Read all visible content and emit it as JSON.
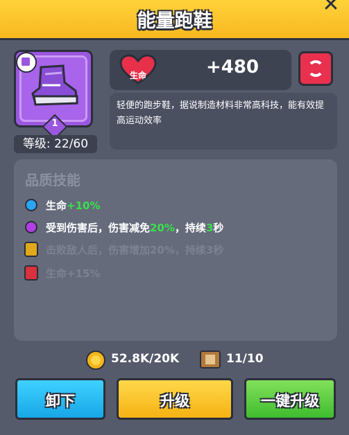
{
  "header": {
    "title": "能量跑鞋",
    "close_symbol": "✕"
  },
  "item": {
    "rank": "1",
    "level": "等级: 22/60"
  },
  "stat": {
    "label": "生命",
    "value": "+480"
  },
  "description": "轻便的跑步鞋，据说制造材料非常高科技，能有效提高运动效率",
  "skills": {
    "title": "品质技能",
    "rows": [
      {
        "pre": "生命",
        "hl": "+10%",
        "mid": "",
        "hl2": "",
        "post": "",
        "state": "unlocked"
      },
      {
        "pre": "受到伤害后，伤害减免",
        "hl": "20%",
        "mid": "，持续",
        "hl2": "3",
        "post": "秒",
        "state": "unlocked"
      },
      {
        "text": "击败敌人后，伤害增加20%，持续3秒",
        "state": "locked"
      },
      {
        "text": "生命+15%",
        "state": "locked"
      }
    ]
  },
  "resources": {
    "gold": "52.8K/20K",
    "scrolls": "11/10"
  },
  "buttons": {
    "unequip": "卸下",
    "upgrade": "升级",
    "one_click_upgrade": "一键升级"
  },
  "colors": {
    "header": "#f7b81f",
    "rarity": "#9b57e0",
    "positive": "#39e04c",
    "hp_dot": "#2aa4f4",
    "skill2_dot": "#b33ee6",
    "lock_gold": "#e0a91a",
    "lock_red": "#d8323d"
  }
}
